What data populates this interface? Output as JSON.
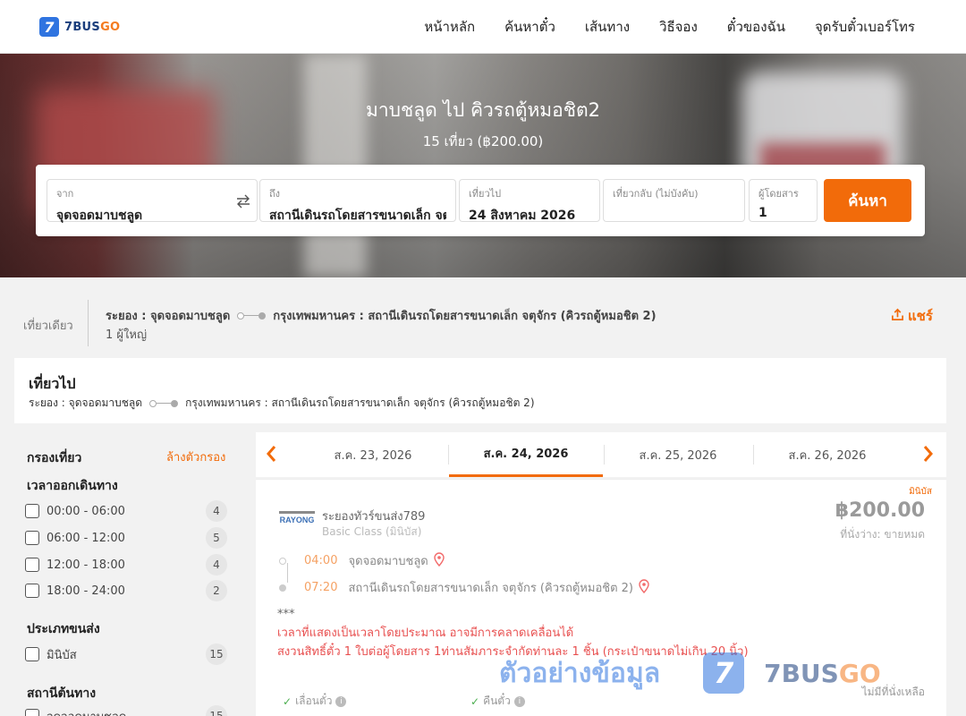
{
  "brand": {
    "number": "7",
    "name": "7BUS",
    "suffix": "GO"
  },
  "nav": [
    "หน้าหลัก",
    "ค้นหาตั๋ว",
    "เส้นทาง",
    "วิธีจอง",
    "ตั๋วของฉัน",
    "จุดรับตั๋วเบอร์โทร"
  ],
  "hero": {
    "title": "มาบชลูด ไป คิวรถตู้หมอชิต2",
    "subtitle": "15 เที่ยว (฿200.00)"
  },
  "search": {
    "from_label": "จาก",
    "from_value": "จุดจอดมาบชลูด",
    "to_label": "ถึง",
    "to_value": "สถานีเดินรถโดยสารขนาดเล็ก จตุจักร",
    "depart_label": "เที่ยวไป",
    "depart_value": "24 สิงหาคม 2026",
    "return_label": "เที่ยวกลับ (ไม่บังคับ)",
    "return_value": "",
    "pax_label": "ผู้โดยสาร",
    "pax_value": "1",
    "button": "ค้นหา"
  },
  "summary": {
    "trip_type": "เที่ยวเดียว",
    "origin": "ระยอง : จุดจอดมาบชลูด",
    "destination": "กรุงเทพมหานคร : สถานีเดินรถโดยสารขนาดเล็ก จตุจักร (คิวรถตู้หมอชิต 2)",
    "passengers": "1 ผู้ใหญ่",
    "share": "แชร์"
  },
  "outbound": {
    "heading": "เที่ยวไป",
    "origin": "ระยอง : จุดจอดมาบชลูด",
    "destination": "กรุงเทพมหานคร : สถานีเดินรถโดยสารขนาดเล็ก จตุจักร (คิวรถตู้หมอชิต 2)"
  },
  "filter": {
    "title": "กรองเที่ยว",
    "clear": "ล้างตัวกรอง",
    "time_section": "เวลาออกเดินทาง",
    "times": [
      {
        "label": "00:00 - 06:00",
        "count": "4"
      },
      {
        "label": "06:00 - 12:00",
        "count": "5"
      },
      {
        "label": "12:00 - 18:00",
        "count": "4"
      },
      {
        "label": "18:00 - 24:00",
        "count": "2"
      }
    ],
    "type_section": "ประเภทขนส่ง",
    "types": [
      {
        "label": "มินิบัส",
        "count": "15"
      }
    ],
    "station_section": "สถานีต้นทาง",
    "stations": [
      {
        "label": "จุดจอดมาบชลูด",
        "count": "15"
      }
    ]
  },
  "dates": [
    "ส.ค. 23, 2026",
    "ส.ค. 24, 2026",
    "ส.ค. 25, 2026",
    "ส.ค. 26, 2026"
  ],
  "active_date_index": 1,
  "result": {
    "badge": "มินิบัส",
    "operator": "ระยองทัวร์ขนส่ง789",
    "operator_logo_text": "RAYONG",
    "class": "Basic Class (มินิบัส)",
    "price": "฿200.00",
    "seats": "ที่นั่งว่าง: ขายหมด",
    "depart_time": "04:00",
    "depart_place": "จุดจอดมาบชลูด",
    "arrive_time": "07:20",
    "arrive_place": "สถานีเดินรถโดยสารขนาดเล็ก จตุจักร (คิวรถตู้หมอชิต 2)",
    "note_stars": "***",
    "note_1": "เวลาที่แสดงเป็นเวลาโดยประมาณ อาจมีการคลาดเคลื่อนได้",
    "note_2": "สงวนสิทธิ์ตั๋ว 1 ใบต่อผู้โดยสาร 1ท่านสัมภาระจำกัดท่านละ 1 ชิ้น (กระเป๋าขนาดไม่เกิน 20 นิ้ว)",
    "feature_1": "เลื่อนตั๋ว",
    "feature_2": "คืนตั๋ว",
    "sold_out": "ไม่มีที่นั่งเหลือ"
  },
  "watermark": {
    "text": "ตัวอย่างข้อมูล",
    "logo_number": "7",
    "brand": "7BUS",
    "brand_suffix": "GO"
  },
  "colors": {
    "accent": "#f26b0a",
    "brand_blue": "#2f74e0",
    "warning_red": "#e85050"
  },
  "icons": {
    "swap": "swap-arrows-icon",
    "share": "share-upload-icon",
    "pin": "map-pin-icon",
    "check": "check-icon",
    "info": "info-icon",
    "prev": "chevron-left-icon",
    "next": "chevron-right-icon"
  }
}
